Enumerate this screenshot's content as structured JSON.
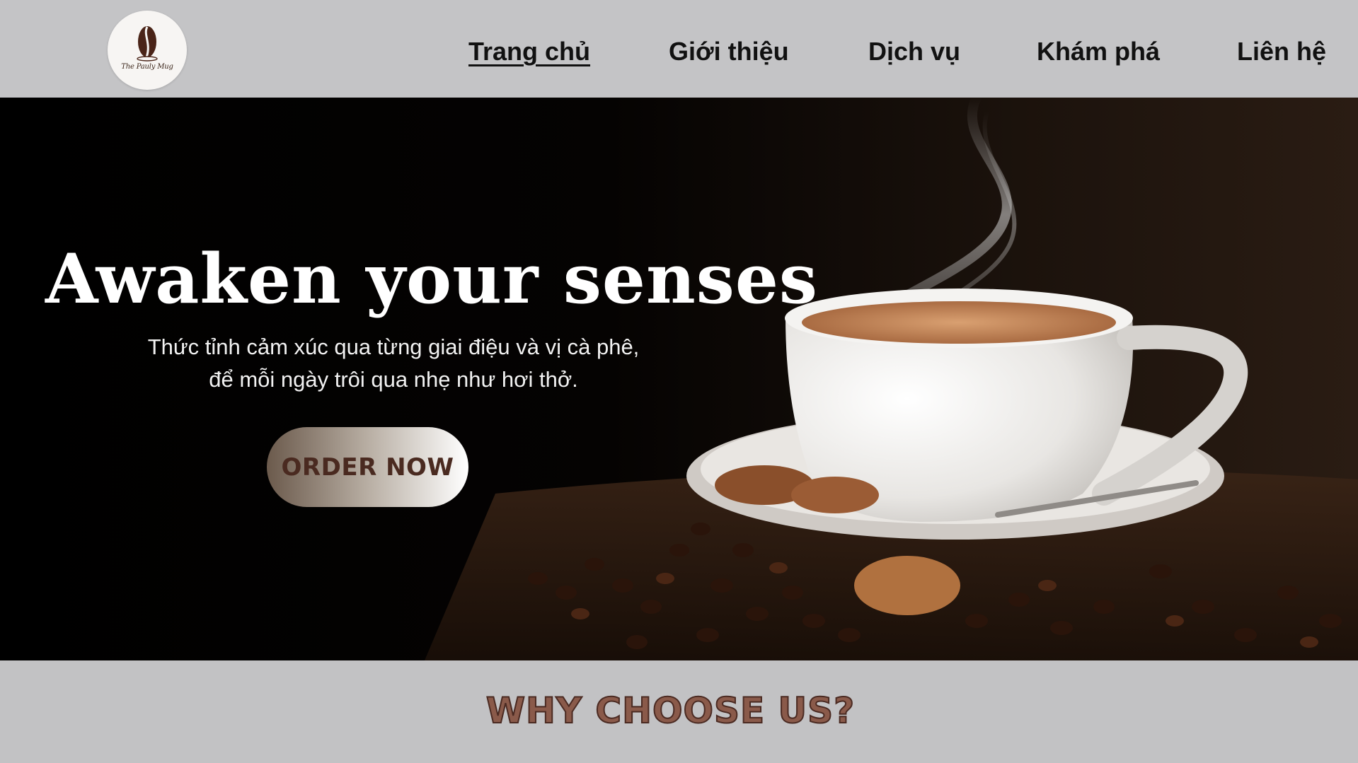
{
  "header": {
    "logo_text": "The Pauly Mug",
    "nav": [
      {
        "label": "Trang chủ",
        "active": true
      },
      {
        "label": "Giới thiệu",
        "active": false
      },
      {
        "label": "Dịch vụ",
        "active": false
      },
      {
        "label": "Khám phá",
        "active": false
      },
      {
        "label": "Liên hệ",
        "active": false
      }
    ]
  },
  "hero": {
    "title": "Awaken your senses",
    "subtitle_line1": "Thức tỉnh cảm xúc qua từng giai điệu và vị cà phê,",
    "subtitle_line2": "để mỗi ngày trôi qua nhẹ như hơi thở.",
    "cta_label": "ORDER NOW",
    "image": "coffee-cup-with-beans-and-cookies"
  },
  "section": {
    "title": "WHY CHOOSE US?"
  },
  "colors": {
    "header_bg": "#c4c4c6",
    "hero_bg": "#000000",
    "accent_brown": "#4a2a20",
    "section_title": "#8a5a4a"
  },
  "icons": {
    "logo": "coffee-bean-icon"
  }
}
